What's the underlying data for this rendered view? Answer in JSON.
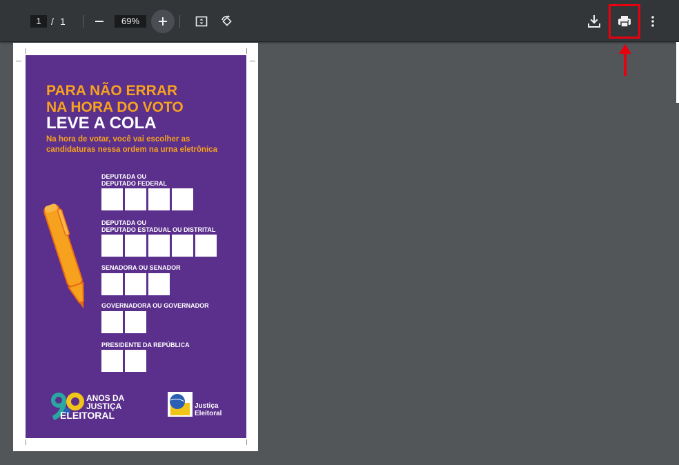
{
  "toolbar": {
    "page_current": "1",
    "page_separator": "/",
    "page_total": "1",
    "zoom": "69%",
    "zoom_out_icon": "minus-icon",
    "zoom_in_icon": "plus-icon",
    "fit_icon": "fit-page-icon",
    "rotate_icon": "rotate-icon",
    "download_icon": "download-icon",
    "print_icon": "print-icon",
    "more_icon": "more-vert-icon",
    "highlight_color": "#e8000f"
  },
  "poster": {
    "line1": "PARA NÃO ERRAR",
    "line2": "NA HORA DO VOTO",
    "line3": "LEVE A COLA",
    "subtitle1": "Na hora de votar, você vai escolher as",
    "subtitle2": "candidaturas nessa ordem na urna eletrônica",
    "fields": [
      {
        "label1": "DEPUTADA OU",
        "label2": "DEPUTADO FEDERAL",
        "boxes": 4
      },
      {
        "label1": "DEPUTADA OU",
        "label2": "DEPUTADO ESTADUAL OU DISTRITAL",
        "boxes": 5
      },
      {
        "label1": "SENADORA OU SENADOR",
        "label2": "",
        "boxes": 3
      },
      {
        "label1": "GOVERNADORA OU GOVERNADOR",
        "label2": "",
        "boxes": 2
      },
      {
        "label1": "PRESIDENTE DA REPÚBLICA",
        "label2": "",
        "boxes": 2
      }
    ],
    "logo_left_line1": "ANOS DA",
    "logo_left_line2": "JUSTIÇA",
    "logo_left_line3": "ELEITORAL",
    "logo_right_line1": "Justiça",
    "logo_right_line2": "Eleitoral",
    "colors": {
      "background": "#5b2f8c",
      "accent": "#f6a21e",
      "text": "#ffffff"
    }
  }
}
